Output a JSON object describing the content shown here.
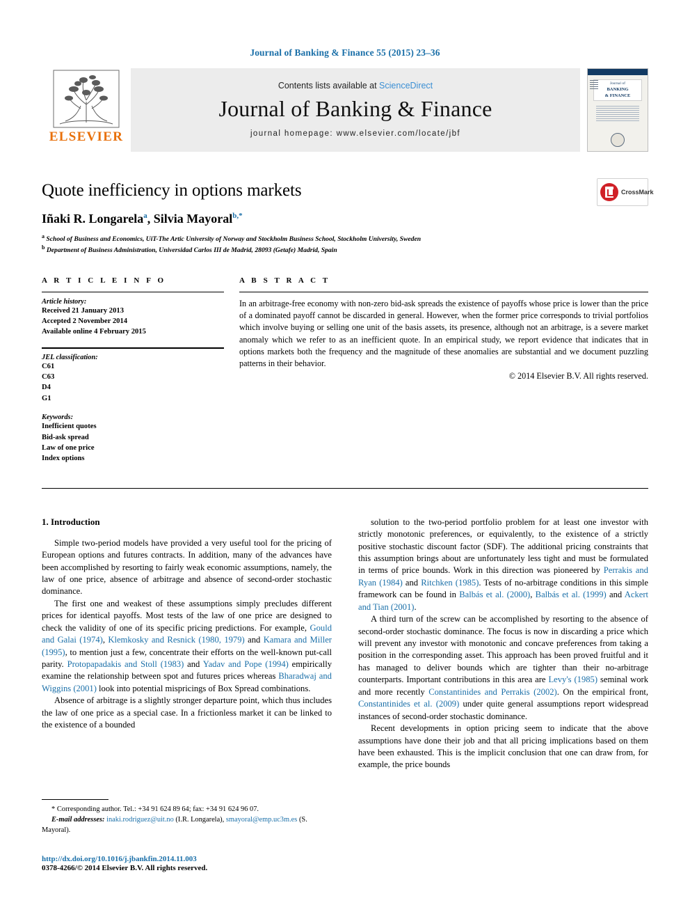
{
  "running_head": "Journal of Banking & Finance 55 (2015) 23–36",
  "masthead": {
    "publisher_name": "ELSEVIER",
    "contents_prefix": "Contents lists available at ",
    "sciencedirect": "ScienceDirect",
    "journal_title": "Journal of Banking & Finance",
    "homepage": "journal homepage: www.elsevier.com/locate/jbf",
    "cover": {
      "line1": "Journal of",
      "line2": "BANKING",
      "line3": "& FINANCE"
    }
  },
  "article": {
    "title": "Quote inefficiency in options markets",
    "authors": "Iñaki R. Longarela ᵃ, Silvia Mayoral ᵇ,*",
    "author_1_name": "Iñaki R. Longarela",
    "author_1_sup": "a",
    "author_2_name": "Silvia Mayoral",
    "author_2_sup": "b,*",
    "affiliation_a_sup": "a",
    "affiliation_a": "School of Business and Economics, UiT-The Artic University of Norway and Stockholm Business School, Stockholm University, Sweden",
    "affiliation_b_sup": "b",
    "affiliation_b": "Department of Business Administration, Universidad Carlos III de Madrid, 28093 (Getafe) Madrid, Spain",
    "crossmark_label": "CrossMark"
  },
  "article_info": {
    "heading": "A R T I C L E   I N F O",
    "history_label": "Article history:",
    "history": [
      "Received 21 January 2013",
      "Accepted 2 November 2014",
      "Available online 4 February 2015"
    ],
    "jel_label": "JEL classification:",
    "jel_codes": [
      "C61",
      "C63",
      "D4",
      "G1"
    ],
    "keywords_label": "Keywords:",
    "keywords": [
      "Inefficient quotes",
      "Bid-ask spread",
      "Law of one price",
      "Index options"
    ]
  },
  "abstract": {
    "heading": "A B S T R A C T",
    "text": "In an arbitrage-free economy with non-zero bid-ask spreads the existence of payoffs whose price is lower than the price of a dominated payoff cannot be discarded in general. However, when the former price corresponds to trivial portfolios which involve buying or selling one unit of the basis assets, its presence, although not an arbitrage, is a severe market anomaly which we refer to as an inefficient quote. In an empirical study, we report evidence that indicates that in options markets both the frequency and the magnitude of these anomalies are substantial and we document puzzling patterns in their behavior.",
    "copyright": "© 2014 Elsevier B.V. All rights reserved."
  },
  "body": {
    "section_title": "1. Introduction",
    "left_paragraphs": [
      "Simple two-period models have provided a very useful tool for the pricing of European options and futures contracts. In addition, many of the advances have been accomplished by resorting to fairly weak economic assumptions, namely, the law of one price, absence of arbitrage and absence of second-order stochastic dominance.",
      "The first one and weakest of these assumptions simply precludes different prices for identical payoffs. Most tests of the law of one price are designed to check the validity of one of its specific pricing predictions. For example, Gould and Galai (1974), Klemkosky and Resnick (1980, 1979) and Kamara and Miller (1995), to mention just a few, concentrate their efforts on the well-known put-call parity. Protopapadakis and Stoll (1983) and Yadav and Pope (1994) empirically examine the relationship between spot and futures prices whereas Bharadwaj and Wiggins (2001) look into potential mispricings of Box Spread combinations.",
      "Absence of arbitrage is a slightly stronger departure point, which thus includes the law of one price as a special case. In a frictionless market it can be linked to the existence of a bounded"
    ],
    "right_paragraphs": [
      "solution to the two-period portfolio problem for at least one investor with strictly monotonic preferences, or equivalently, to the existence of a strictly positive stochastic discount factor (SDF). The additional pricing constraints that this assumption brings about are unfortunately less tight and must be formulated in terms of price bounds. Work in this direction was pioneered by Perrakis and Ryan (1984) and Ritchken (1985). Tests of no-arbitrage conditions in this simple framework can be found in Balbás et al. (2000), Balbás et al. (1999) and Ackert and Tian (2001).",
      "A third turn of the screw can be accomplished by resorting to the absence of second-order stochastic dominance. The focus is now in discarding a price which will prevent any investor with monotonic and concave preferences from taking a position in the corresponding asset. This approach has been proved fruitful and it has managed to deliver bounds which are tighter than their no-arbitrage counterparts. Important contributions in this area are Levy's (1985) seminal work and more recently Constantinides and Perrakis (2002). On the empirical front, Constantinides et al. (2009) under quite general assumptions report widespread instances of second-order stochastic dominance.",
      "Recent developments in option pricing seem to indicate that the above assumptions have done their job and that all pricing implications based on them have been exhausted. This is the implicit conclusion that one can draw from, for example, the price bounds"
    ],
    "references_in_text": [
      "Gould and Galai (1974)",
      "Klemkosky and Resnick (1980, 1979)",
      "Kamara and Miller (1995)",
      "Protopapadakis and Stoll (1983)",
      "Yadav and Pope (1994)",
      "Bharadwaj and Wiggins (2001)",
      "Perrakis and Ryan (1984)",
      "Ritchken (1985)",
      "Balbás et al. (2000)",
      "Balbás et al. (1999)",
      "Ackert and Tian (2001)",
      "Levy's (1985)",
      "Constantinides and Perrakis (2002)",
      "Constantinides et al. (2009)"
    ]
  },
  "footnote": {
    "star": "*",
    "corresponding": "Corresponding author. Tel.: +34 91 624 89 64; fax: +34 91 624 96 07.",
    "email_label": "E-mail addresses:",
    "email_1": "inaki.rodriguez@uit.no",
    "email_1_owner": "(I.R. Longarela),",
    "email_2": "smayoral@emp.uc3m.es",
    "email_2_owner": "(S. Mayoral)."
  },
  "imprint": {
    "doi": "http://dx.doi.org/10.1016/j.jbankfin.2014.11.003",
    "issn_copyright": "0378-4266/© 2014 Elsevier B.V. All rights reserved."
  },
  "colors": {
    "link_blue": "#1a6fa8",
    "sciencedirect_blue": "#3b8fd4",
    "elsevier_orange": "#e8700a",
    "crossmark_red": "#d02128",
    "masthead_gray": "#ececec"
  }
}
